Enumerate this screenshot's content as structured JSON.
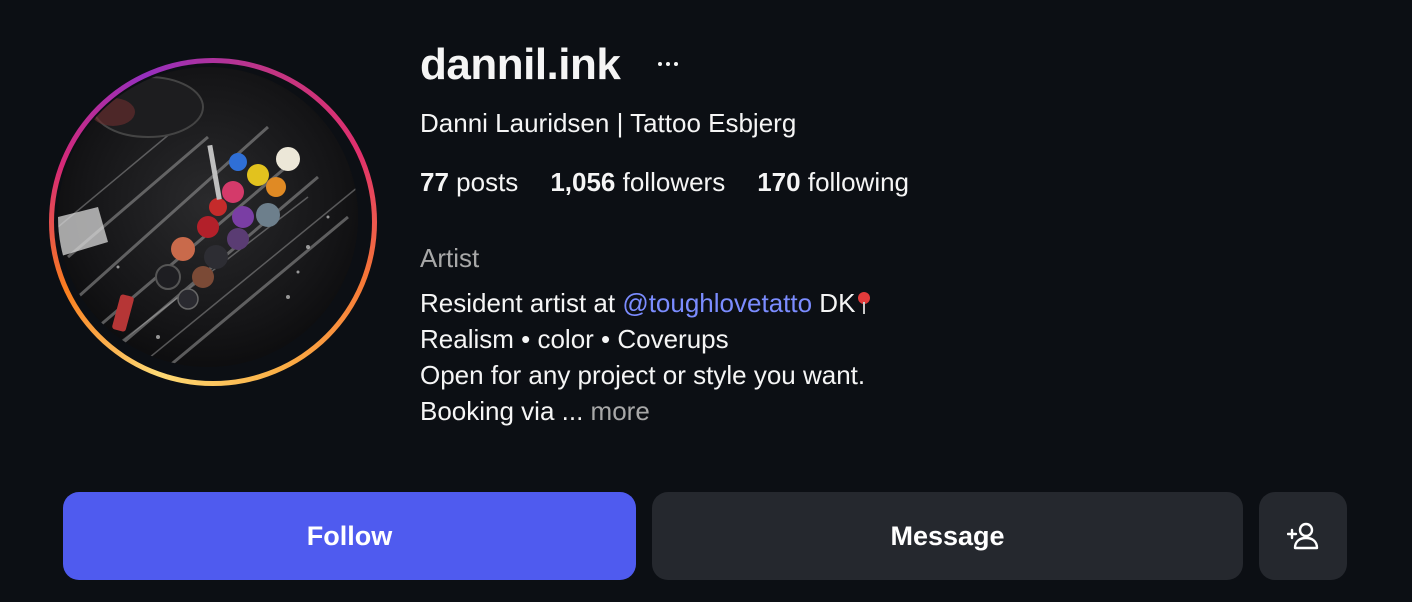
{
  "profile": {
    "username": "dannil.ink",
    "full_name": "Danni Lauridsen | Tattoo Esbjerg",
    "category": "Artist"
  },
  "stats": {
    "posts_count": "77",
    "posts_label": "posts",
    "followers_count": "1,056",
    "followers_label": "followers",
    "following_count": "170",
    "following_label": "following"
  },
  "bio": {
    "line1_prefix": "Resident artist at ",
    "line1_mention": "@toughlovetatto",
    "line1_suffix": " DK",
    "line2": "Realism • color • Coverups",
    "line3": "Open for any project or style you want.",
    "line4": "Booking via ... ",
    "more_label": "more"
  },
  "actions": {
    "follow_label": "Follow",
    "message_label": "Message",
    "suggest_icon": "person-add-icon"
  },
  "icons": {
    "options": "more-horizontal-icon",
    "location": "round-pushpin-icon"
  },
  "colors": {
    "background": "#0c0f14",
    "follow_button": "#4f5bef",
    "secondary_button": "#25282e",
    "mention": "#7b8cff",
    "muted_text": "#a8a8a8"
  }
}
